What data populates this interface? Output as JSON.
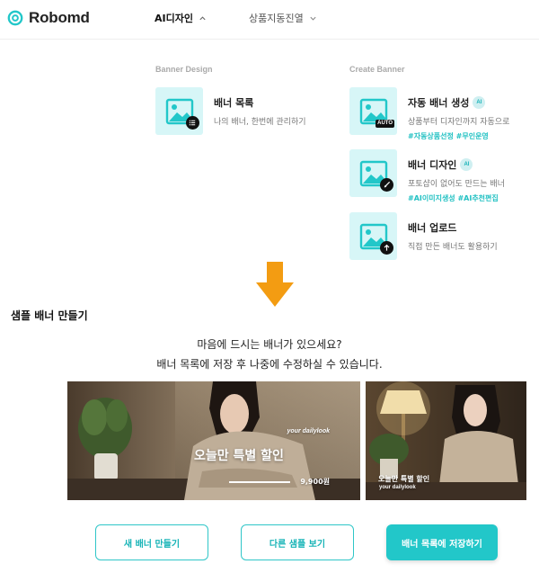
{
  "brand": {
    "name": "Robomd",
    "accent": "#22c7c9"
  },
  "nav": {
    "ai_design": "AI디자인",
    "product_display": "상품지동진열"
  },
  "menu": {
    "banner_design": {
      "title": "Banner Design",
      "items": [
        {
          "icon": "image-list-icon",
          "label": "배너 목록",
          "desc": "나의 배너, 한번에 관리하기"
        }
      ]
    },
    "create_banner": {
      "title": "Create Banner",
      "items": [
        {
          "icon": "image-auto-icon",
          "badge": "AUTO",
          "label": "자동 배너 생성",
          "ai": "AI",
          "desc": "상품부터 디자인까지 자동으로",
          "tags": "#자동상품선정 #무인운영"
        },
        {
          "icon": "image-brush-icon",
          "label": "배너 디자인",
          "ai": "AI",
          "desc": "포토샵이 없어도 만드는 배너",
          "tags": "#AI이미지생성 #AI추천편집"
        },
        {
          "icon": "image-upload-icon",
          "label": "배너 업로드",
          "desc": "직접 만든 배너도 활용하기"
        }
      ]
    }
  },
  "section": {
    "title": "샘플 배너 만들기",
    "question_line1": "마음에 드시는 배너가 있으세요?",
    "question_line2": "배너 목록에 저장 후 나중에 수정하실 수 있습니다."
  },
  "banners": {
    "big": {
      "tag": "your dailylook",
      "headline": "오늘만 특별 할인",
      "price": "9,900원"
    },
    "small": {
      "headline": "오늘만 특별 할인",
      "tag": "your dailylook"
    }
  },
  "buttons": {
    "new_banner": "새 배너 만들기",
    "other_samples": "다른 샘플 보기",
    "save_to_list": "배너 목록에 저장하기"
  }
}
